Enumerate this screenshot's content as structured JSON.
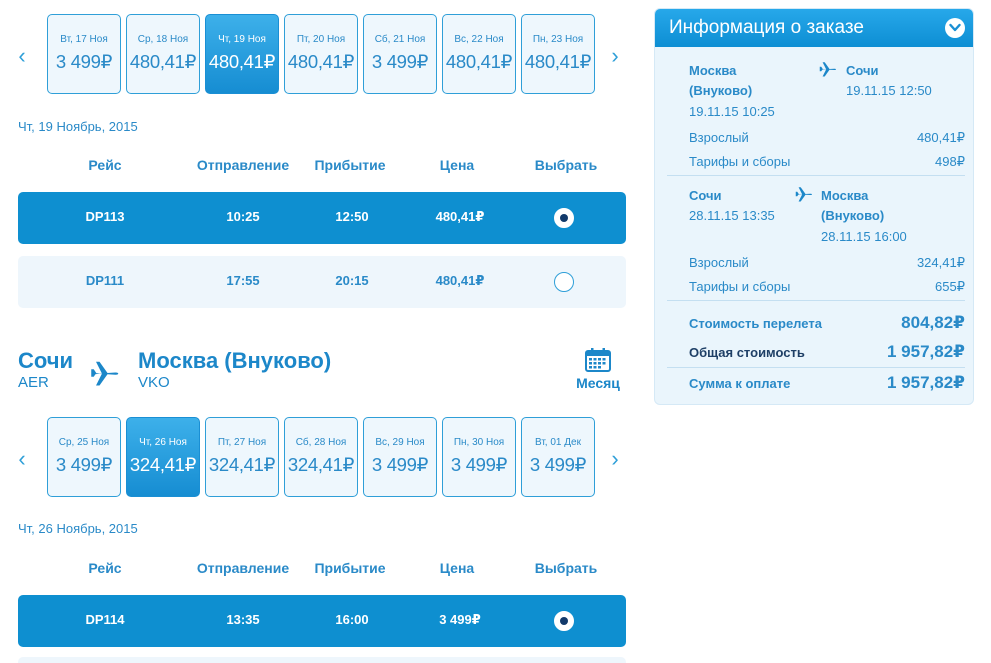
{
  "currency": "₽",
  "outbound": {
    "prev_arrow": "‹",
    "next_arrow": "›",
    "days": [
      {
        "label": "Вт, 17 Ноя",
        "price": "3 499₽"
      },
      {
        "label": "Ср, 18 Ноя",
        "price": "480,41₽"
      },
      {
        "label": "Чт, 19 Ноя",
        "price": "480,41₽",
        "selected": true
      },
      {
        "label": "Пт, 20 Ноя",
        "price": "480,41₽"
      },
      {
        "label": "Сб, 21 Ноя",
        "price": "3 499₽"
      },
      {
        "label": "Вс, 22 Ноя",
        "price": "480,41₽"
      },
      {
        "label": "Пн, 23 Ноя",
        "price": "480,41₽"
      }
    ],
    "date_header": "Чт, 19 Ноябрь, 2015",
    "columns": {
      "flight": "Рейс",
      "departure": "Отправление",
      "arrival": "Прибытие",
      "price": "Цена",
      "select": "Выбрать"
    },
    "flights": [
      {
        "flight": "DP113",
        "departure": "10:25",
        "arrival": "12:50",
        "price": "480,41₽",
        "selected": true
      },
      {
        "flight": "DP111",
        "departure": "17:55",
        "arrival": "20:15",
        "price": "480,41₽",
        "selected": false
      }
    ]
  },
  "return_route": {
    "from_city": "Сочи",
    "from_code": "AER",
    "to_city": "Москва (Внуково)",
    "to_code": "VKO",
    "month_label": "Месяц"
  },
  "inbound": {
    "prev_arrow": "‹",
    "next_arrow": "›",
    "days": [
      {
        "label": "Ср, 25 Ноя",
        "price": "3 499₽"
      },
      {
        "label": "Чт, 26 Ноя",
        "price": "324,41₽",
        "selected": true
      },
      {
        "label": "Пт, 27 Ноя",
        "price": "324,41₽"
      },
      {
        "label": "Сб, 28 Ноя",
        "price": "324,41₽"
      },
      {
        "label": "Вс, 29 Ноя",
        "price": "3 499₽"
      },
      {
        "label": "Пн, 30 Ноя",
        "price": "3 499₽"
      },
      {
        "label": "Вт, 01 Дек",
        "price": "3 499₽"
      }
    ],
    "date_header": "Чт, 26 Ноябрь, 2015",
    "columns": {
      "flight": "Рейс",
      "departure": "Отправление",
      "arrival": "Прибытие",
      "price": "Цена",
      "select": "Выбрать"
    },
    "flights": [
      {
        "flight": "DP114",
        "departure": "13:35",
        "arrival": "16:00",
        "price": "3 499₽",
        "selected": true
      }
    ]
  },
  "order": {
    "title": "Информация о заказе",
    "segment1": {
      "from_line1": "Москва",
      "from_line2": "(Внуково)",
      "from_datetime": "19.11.15 10:25",
      "to_line1": "Сочи",
      "to_datetime": "19.11.15 12:50",
      "adult_label": "Взрослый",
      "adult_price": "480,41₽",
      "fees_label": "Тарифы и сборы",
      "fees_price": "498₽"
    },
    "segment2": {
      "from_line1": "Сочи",
      "from_datetime": "28.11.15 13:35",
      "to_line1": "Москва",
      "to_line2": "(Внуково)",
      "to_datetime": "28.11.15 16:00",
      "adult_label": "Взрослый",
      "adult_price": "324,41₽",
      "fees_label": "Тарифы и сборы",
      "fees_price": "655₽"
    },
    "flight_cost_label": "Стоимость перелета",
    "flight_cost": "804,82₽",
    "total_label": "Общая стоимость",
    "total": "1 957,82₽",
    "pay_label": "Сумма к оплате",
    "pay": "1 957,82₽"
  },
  "colors": {
    "accent": "#0e8fd0",
    "panel_bg": "#eaf5fc",
    "text": "#2a8ac8"
  }
}
